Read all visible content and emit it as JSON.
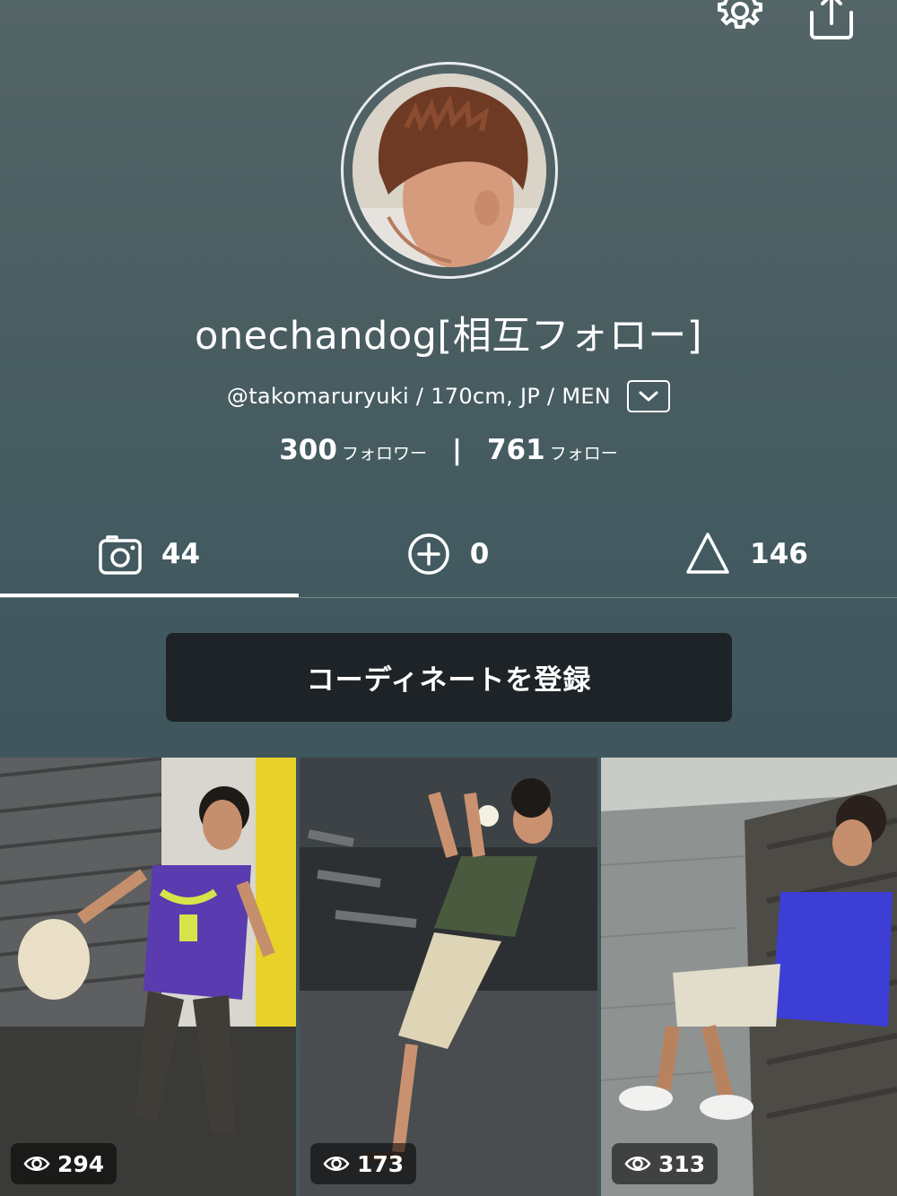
{
  "header": {
    "settings_icon": "gear-icon",
    "share_icon": "share-icon"
  },
  "profile": {
    "display_name": "onechandog[相互フォロー]",
    "meta": "@takomaruryuki / 170cm, JP / MEN",
    "followers_count": "300",
    "followers_label": "フォロワー",
    "following_count": "761",
    "following_label": "フォロー",
    "separator": "|"
  },
  "tabs": [
    {
      "icon": "camera-icon",
      "count": "44",
      "active": true
    },
    {
      "icon": "plus-circle-icon",
      "count": "0",
      "active": false
    },
    {
      "icon": "hanger-icon",
      "count": "146",
      "active": false
    }
  ],
  "actions": {
    "register_label": "コーディネートを登録"
  },
  "posts": [
    {
      "views": "294",
      "shirt_color": "#5a3bb0"
    },
    {
      "views": "173",
      "shirt_color": "#4a5a3e"
    },
    {
      "views": "313",
      "shirt_color": "#3c3ed6"
    }
  ]
}
